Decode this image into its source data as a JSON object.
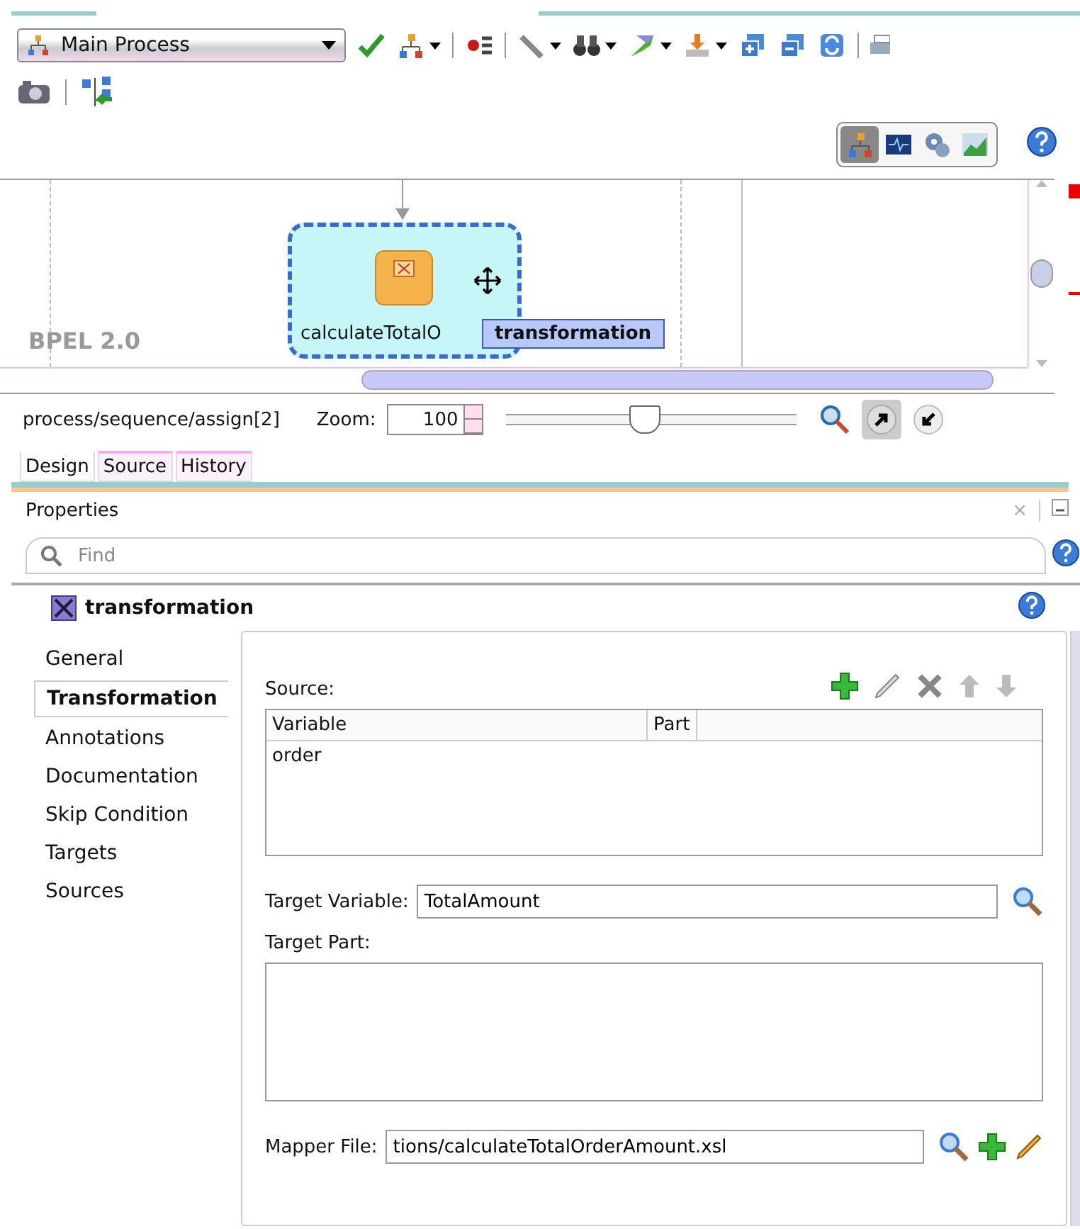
{
  "toolbar": {
    "process_selector": {
      "value": "Main Process"
    }
  },
  "view_modes": [
    {
      "kind": "design",
      "selected": true
    },
    {
      "kind": "monitor",
      "selected": false
    },
    {
      "kind": "gears",
      "selected": false
    },
    {
      "kind": "chart",
      "selected": false
    }
  ],
  "canvas": {
    "watermark": "BPEL 2.0",
    "node": {
      "label": "calculateTotalO",
      "selected": true
    },
    "tooltip": "transformation"
  },
  "status": {
    "path": "process/sequence/assign[2]",
    "zoom_label": "Zoom:",
    "zoom_value": "100",
    "zoom_slider": {
      "level": 0.47
    }
  },
  "editor_tabs": [
    {
      "label": "Design",
      "selected": true
    },
    {
      "label": "Source",
      "selected": false
    },
    {
      "label": "History",
      "selected": false
    }
  ],
  "properties": {
    "title": "Properties",
    "close": "×",
    "search": {
      "placeholder": "Find"
    },
    "heading": "transformation",
    "nav": [
      {
        "label": "General",
        "selected": false
      },
      {
        "label": "Transformation",
        "selected": true
      },
      {
        "label": "Annotations",
        "selected": false
      },
      {
        "label": "Documentation",
        "selected": false
      },
      {
        "label": "Skip Condition",
        "selected": false
      },
      {
        "label": "Targets",
        "selected": false
      },
      {
        "label": "Sources",
        "selected": false
      }
    ],
    "source": {
      "label": "Source:",
      "columns": [
        "Variable",
        "Part"
      ],
      "rows": [
        {
          "variable": "order"
        }
      ]
    },
    "target_variable": {
      "label": "Target Variable:",
      "value": "TotalAmount"
    },
    "target_part": {
      "label": "Target Part:"
    },
    "mapper_file": {
      "label": "Mapper File:",
      "value": "tions/calculateTotalOrderAmount.xsl"
    }
  }
}
